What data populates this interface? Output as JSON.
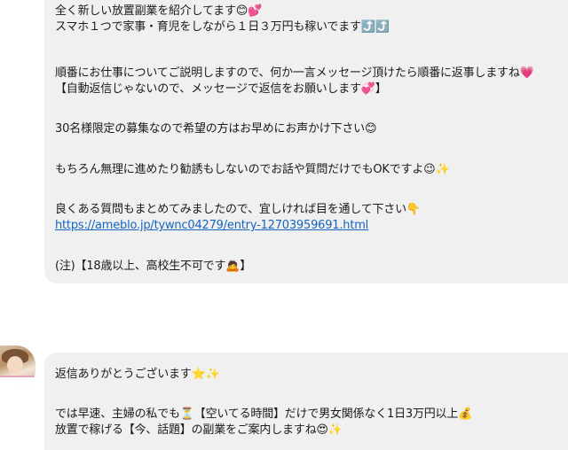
{
  "message_1": {
    "lines": [
      "全く新しい放置副業を紹介してます😊💕",
      "スマホ１つで家事・育児をしながら１日３万円も稼いでます⤴️⤴️",
      "順番にお仕事についてご説明しますので、何か一言メッセージ頂けたら順番に返事しますね💗",
      "【自動返信じゃないので、メッセージで返信をお願いします💞】",
      "30名様限定の募集なので希望の方はお早めにお声かけ下さい😊",
      "もちろん無理に進めたり勧誘もしないのでお話や質問だけでもOKですよ😉✨",
      "良くある質問もまとめてみましたので、宜しければ目を通して下さい👇",
      "(注)【18歳以上、高校生不可です🙇】"
    ],
    "link": "https://ameblo.jp/tywnc04279/entry-12703959691.html"
  },
  "message_2": {
    "lines": [
      "返信ありがとうございます⭐✨",
      "では早速、主婦の私でも⏳【空いてる時間】だけで男女関係なく1日3万円以上💰",
      "放置で稼げる【今、話題】の副業をご案内しますね😍✨"
    ]
  }
}
